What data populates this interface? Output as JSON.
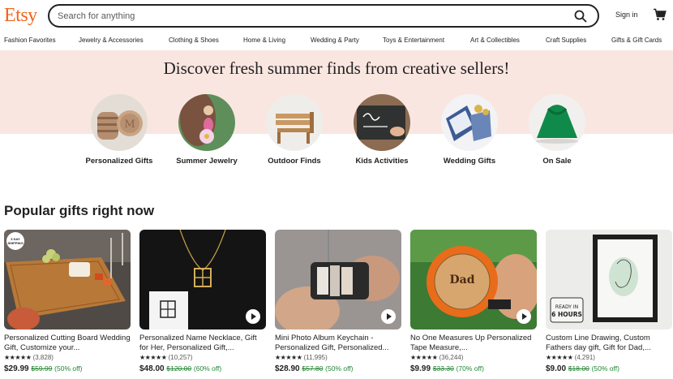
{
  "header": {
    "logo": "Etsy",
    "search_placeholder": "Search for anything",
    "signin": "Sign in"
  },
  "nav": [
    "Fashion Favorites",
    "Jewelry & Accessories",
    "Clothing & Shoes",
    "Home & Living",
    "Wedding & Party",
    "Toys & Entertainment",
    "Art & Collectibles",
    "Craft Supplies",
    "Gifts & Gift Cards"
  ],
  "hero": {
    "title": "Discover fresh summer finds from creative sellers!"
  },
  "categories": [
    {
      "label": "Personalized Gifts"
    },
    {
      "label": "Summer Jewelry"
    },
    {
      "label": "Outdoor Finds"
    },
    {
      "label": "Kids Activities"
    },
    {
      "label": "Wedding Gifts"
    },
    {
      "label": "On Sale"
    }
  ],
  "popular": {
    "title": "Popular gifts right now",
    "items": [
      {
        "title": "Personalized Cutting Board Wedding Gift, Customize your...",
        "stars": "★★★★★",
        "reviews": "(3,828)",
        "price": "$29.99",
        "old_price": "$59.99",
        "discount": "(50% off)",
        "badge": "3 DAY SHIPPING"
      },
      {
        "title": "Personalized Name Necklace, Gift for Her, Personalized Gift,...",
        "stars": "★★★★★",
        "reviews": "(10,257)",
        "price": "$48.00",
        "old_price": "$120.00",
        "discount": "(60% off)"
      },
      {
        "title": "Mini Photo Album Keychain - Personalized Gift, Personalized...",
        "stars": "★★★★★",
        "reviews": "(11,995)",
        "price": "$28.90",
        "old_price": "$57.80",
        "discount": "(50% off)"
      },
      {
        "title": "No One Measures Up Personalized Tape Measure,...",
        "stars": "★★★★★",
        "reviews": "(36,244)",
        "price": "$9.99",
        "old_price": "$33.30",
        "discount": "(70% off)"
      },
      {
        "title": "Custom Line Drawing, Custom Fathers day gift, Gift for Dad,...",
        "stars": "★★★★★",
        "reviews": "(4,291)",
        "price": "$9.00",
        "old_price": "$18.00",
        "discount": "(50% off)"
      }
    ]
  },
  "colors": {
    "brand": "#F1641E",
    "hero_bg": "#FAE6E1",
    "sale_green": "#258635"
  }
}
